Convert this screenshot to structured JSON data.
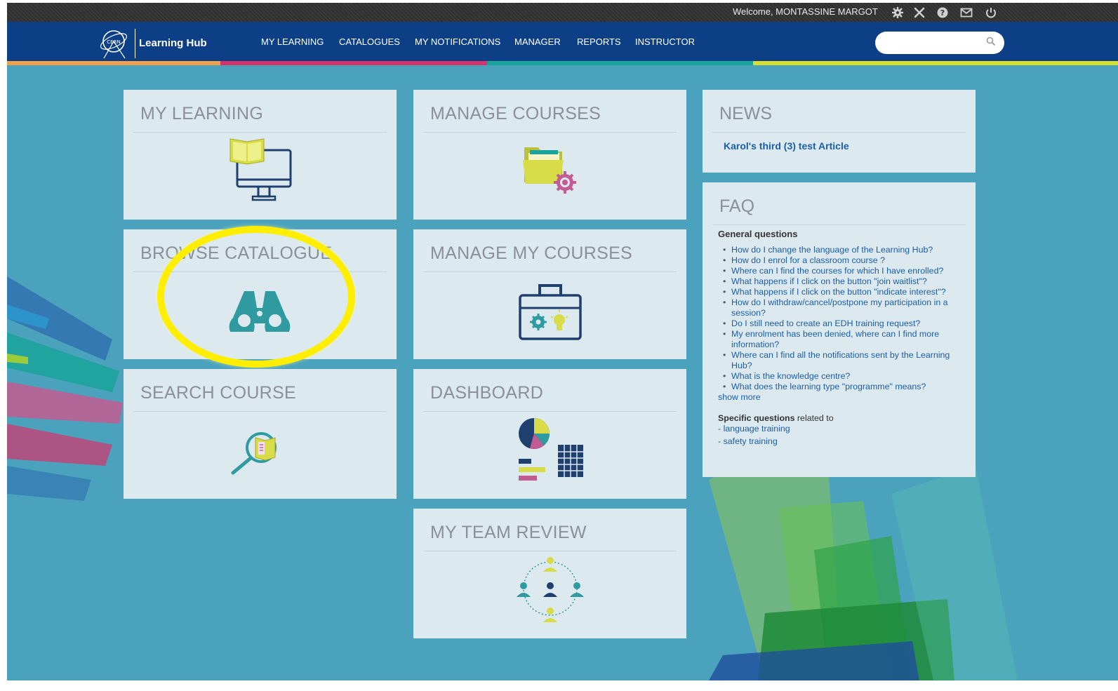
{
  "topbar": {
    "welcome": "Welcome, MONTASSINE MARGOT",
    "icons": [
      "gear-icon",
      "tools-icon",
      "help-icon",
      "mail-icon",
      "power-icon"
    ]
  },
  "navbar": {
    "logo_text": "Learning Hub",
    "items": [
      "MY LEARNING",
      "CATALOGUES",
      "MY NOTIFICATIONS",
      "MANAGER",
      "REPORTS",
      "INSTRUCTOR"
    ],
    "search_placeholder": ""
  },
  "colors": {
    "nav_bg": "#0c3f86",
    "page_bg": "#4aa2bd",
    "tile_bg": "#dce9ef",
    "stripe": [
      "#f0a04b",
      "#d6336c",
      "#1aa39a",
      "#d7e02f"
    ],
    "highlight": "#ffee00"
  },
  "tiles": {
    "my_learning": "MY LEARNING",
    "browse_catalogue": "BROWSE CATALOGUE",
    "search_course": "SEARCH COURSE",
    "manage_courses": "MANAGE COURSES",
    "manage_my_courses": "MANAGE MY COURSES",
    "dashboard": "DASHBOARD",
    "my_team_review": "MY TEAM REVIEW"
  },
  "news": {
    "title": "NEWS",
    "article": "Karol's third (3) test Article"
  },
  "faq": {
    "title": "FAQ",
    "general": "General questions",
    "questions": [
      "How do I change the language of the Learning Hub?",
      "How do I enrol for a classroom course ?",
      "Where can I find the courses for which I have enrolled?",
      "What happens if I click on the button \"join waitlist\"?",
      "What happens if I click on the button \"indicate interest\"?",
      "How do I withdraw/cancel/postpone my participation in a session?",
      "Do I still need to create an EDH training request?",
      "My enrolment has been denied, where can I find more information?",
      "Where can I find all the notifications sent by the Learning Hub?",
      "What is the knowledge centre?",
      "What does the learning type \"programme\" means?"
    ],
    "show_more": "show more",
    "specific_bold": "Specific questions",
    "specific_rest": " related to",
    "links": [
      "- language training",
      "- safety training"
    ]
  }
}
